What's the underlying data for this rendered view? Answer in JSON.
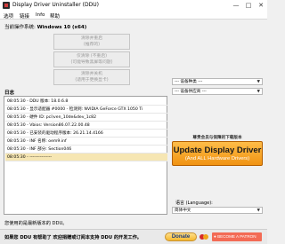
{
  "window": {
    "title": "Display Driver Uninstaller (DDU)",
    "min": "—",
    "max": "□",
    "close": "✕"
  },
  "menu": {
    "options": "选项",
    "links": "链接",
    "info": "Info",
    "help": "帮助"
  },
  "os": {
    "label": "当前操作系统:",
    "value": "Windows 10 (x64)"
  },
  "buttons": {
    "clean_restart": {
      "line1": "清除并重启",
      "line2": "(推荐的)"
    },
    "clean_no_restart": {
      "line1": "仅清除 (不重启)",
      "line2": "(可能导致黑屏等问题)"
    },
    "clean_shutdown": {
      "line1": "清除并关机",
      "line2": "(适用于更换显卡)"
    }
  },
  "log": {
    "title": "日志",
    "rows": [
      "08:05:30 - DDU 版本: 18.0.6.8",
      "08:05:30 - 显示适配器 #0000 - 检测到: NVIDIA GeForce GTX 1050 Ti",
      "08:05:30 - 硬件 ID: pci\\ven_10de&dev_1c82",
      "08:05:30 - Vbios: Version86.07.22.00.48",
      "08:05:30 - 已安装的驱动程序版本: 26.21.14.4166",
      "08:05:30 - INF 名称: oem9.inf",
      "08:05:30 - INF 部分: Section046",
      "08:05:30 - ---------------"
    ]
  },
  "device_type": {
    "value": "--- 设备种类 ---"
  },
  "device_vendor": {
    "value": "--- 设备供应商 ---"
  },
  "promo": {
    "caption": "尊贵会员与保障的下载版本",
    "main": "Update Display Driver",
    "sub": "(And ALL Hardware Drivers)"
  },
  "language": {
    "label": "语言 (Language):",
    "value": "简体中文"
  },
  "status": "您使用的是最新版本的 DDU。",
  "footer": {
    "text": "如果您 DDU 有帮助了 欢迎捐赠或订阅本支持 DDU 的开发工作。",
    "donate": "Donate",
    "patreon": "BECOME A PATRON"
  }
}
